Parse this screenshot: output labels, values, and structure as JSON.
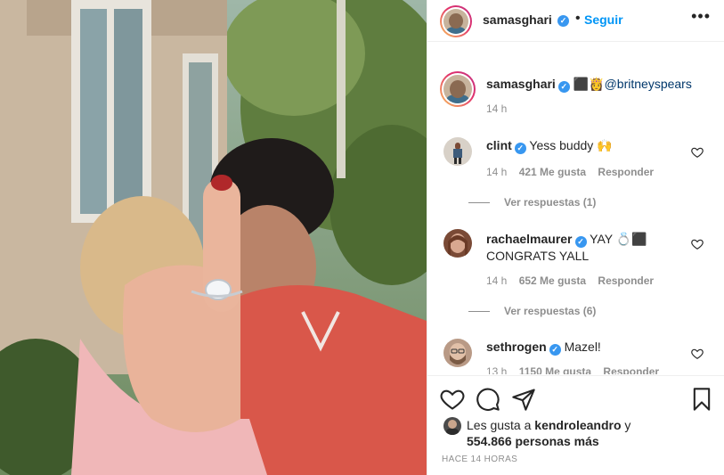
{
  "post": {
    "author": "samasghari",
    "follow_label": "Seguir",
    "more_label": "•••",
    "separator": "•"
  },
  "caption": {
    "username": "samasghari",
    "emoji": "⬛👸",
    "mention": "@britneyspears",
    "time": "14 h"
  },
  "comments": [
    {
      "username": "clint",
      "text": "Yess buddy 🙌",
      "time": "14 h",
      "likes": "421 Me gusta",
      "reply_label": "Responder",
      "view_replies": "Ver respuestas (1)",
      "avatar_color": "#d8d1c8"
    },
    {
      "username": "rachaelmaurer",
      "text": "YAY 💍⬛ CONGRATS YALL",
      "time": "14 h",
      "likes": "652 Me gusta",
      "reply_label": "Responder",
      "view_replies": "Ver respuestas (6)",
      "avatar_color": "#7a4a36"
    },
    {
      "username": "sethrogen",
      "text": "Mazel!",
      "time": "13 h",
      "likes": "1150 Me gusta",
      "reply_label": "Responder",
      "avatar_color": "#b99a86"
    }
  ],
  "likes": {
    "prefix": "Les gusta a",
    "first_user": "kendroleandro",
    "connector": "y",
    "others": "554.866 personas más"
  },
  "posted": "HACE 14 HORAS",
  "icons": [
    "heart-icon",
    "comment-icon",
    "share-icon",
    "bookmark-icon",
    "verified-icon",
    "more-icon"
  ],
  "colors": {
    "accent": "#0095f6",
    "verified": "#3897f0",
    "text": "#262626",
    "muted": "#8e8e8e"
  }
}
